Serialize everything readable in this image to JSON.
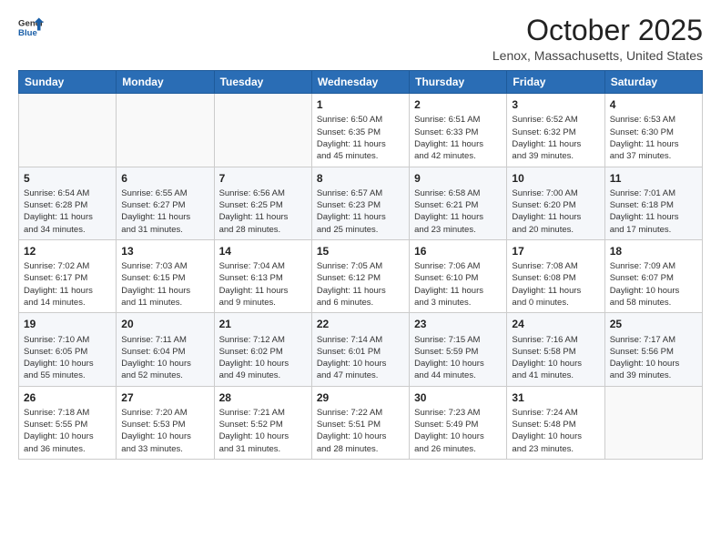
{
  "header": {
    "logo_general": "General",
    "logo_blue": "Blue",
    "month_title": "October 2025",
    "location": "Lenox, Massachusetts, United States"
  },
  "days_of_week": [
    "Sunday",
    "Monday",
    "Tuesday",
    "Wednesday",
    "Thursday",
    "Friday",
    "Saturday"
  ],
  "weeks": [
    [
      {
        "day": "",
        "info": ""
      },
      {
        "day": "",
        "info": ""
      },
      {
        "day": "",
        "info": ""
      },
      {
        "day": "1",
        "info": "Sunrise: 6:50 AM\nSunset: 6:35 PM\nDaylight: 11 hours\nand 45 minutes."
      },
      {
        "day": "2",
        "info": "Sunrise: 6:51 AM\nSunset: 6:33 PM\nDaylight: 11 hours\nand 42 minutes."
      },
      {
        "day": "3",
        "info": "Sunrise: 6:52 AM\nSunset: 6:32 PM\nDaylight: 11 hours\nand 39 minutes."
      },
      {
        "day": "4",
        "info": "Sunrise: 6:53 AM\nSunset: 6:30 PM\nDaylight: 11 hours\nand 37 minutes."
      }
    ],
    [
      {
        "day": "5",
        "info": "Sunrise: 6:54 AM\nSunset: 6:28 PM\nDaylight: 11 hours\nand 34 minutes."
      },
      {
        "day": "6",
        "info": "Sunrise: 6:55 AM\nSunset: 6:27 PM\nDaylight: 11 hours\nand 31 minutes."
      },
      {
        "day": "7",
        "info": "Sunrise: 6:56 AM\nSunset: 6:25 PM\nDaylight: 11 hours\nand 28 minutes."
      },
      {
        "day": "8",
        "info": "Sunrise: 6:57 AM\nSunset: 6:23 PM\nDaylight: 11 hours\nand 25 minutes."
      },
      {
        "day": "9",
        "info": "Sunrise: 6:58 AM\nSunset: 6:21 PM\nDaylight: 11 hours\nand 23 minutes."
      },
      {
        "day": "10",
        "info": "Sunrise: 7:00 AM\nSunset: 6:20 PM\nDaylight: 11 hours\nand 20 minutes."
      },
      {
        "day": "11",
        "info": "Sunrise: 7:01 AM\nSunset: 6:18 PM\nDaylight: 11 hours\nand 17 minutes."
      }
    ],
    [
      {
        "day": "12",
        "info": "Sunrise: 7:02 AM\nSunset: 6:17 PM\nDaylight: 11 hours\nand 14 minutes."
      },
      {
        "day": "13",
        "info": "Sunrise: 7:03 AM\nSunset: 6:15 PM\nDaylight: 11 hours\nand 11 minutes."
      },
      {
        "day": "14",
        "info": "Sunrise: 7:04 AM\nSunset: 6:13 PM\nDaylight: 11 hours\nand 9 minutes."
      },
      {
        "day": "15",
        "info": "Sunrise: 7:05 AM\nSunset: 6:12 PM\nDaylight: 11 hours\nand 6 minutes."
      },
      {
        "day": "16",
        "info": "Sunrise: 7:06 AM\nSunset: 6:10 PM\nDaylight: 11 hours\nand 3 minutes."
      },
      {
        "day": "17",
        "info": "Sunrise: 7:08 AM\nSunset: 6:08 PM\nDaylight: 11 hours\nand 0 minutes."
      },
      {
        "day": "18",
        "info": "Sunrise: 7:09 AM\nSunset: 6:07 PM\nDaylight: 10 hours\nand 58 minutes."
      }
    ],
    [
      {
        "day": "19",
        "info": "Sunrise: 7:10 AM\nSunset: 6:05 PM\nDaylight: 10 hours\nand 55 minutes."
      },
      {
        "day": "20",
        "info": "Sunrise: 7:11 AM\nSunset: 6:04 PM\nDaylight: 10 hours\nand 52 minutes."
      },
      {
        "day": "21",
        "info": "Sunrise: 7:12 AM\nSunset: 6:02 PM\nDaylight: 10 hours\nand 49 minutes."
      },
      {
        "day": "22",
        "info": "Sunrise: 7:14 AM\nSunset: 6:01 PM\nDaylight: 10 hours\nand 47 minutes."
      },
      {
        "day": "23",
        "info": "Sunrise: 7:15 AM\nSunset: 5:59 PM\nDaylight: 10 hours\nand 44 minutes."
      },
      {
        "day": "24",
        "info": "Sunrise: 7:16 AM\nSunset: 5:58 PM\nDaylight: 10 hours\nand 41 minutes."
      },
      {
        "day": "25",
        "info": "Sunrise: 7:17 AM\nSunset: 5:56 PM\nDaylight: 10 hours\nand 39 minutes."
      }
    ],
    [
      {
        "day": "26",
        "info": "Sunrise: 7:18 AM\nSunset: 5:55 PM\nDaylight: 10 hours\nand 36 minutes."
      },
      {
        "day": "27",
        "info": "Sunrise: 7:20 AM\nSunset: 5:53 PM\nDaylight: 10 hours\nand 33 minutes."
      },
      {
        "day": "28",
        "info": "Sunrise: 7:21 AM\nSunset: 5:52 PM\nDaylight: 10 hours\nand 31 minutes."
      },
      {
        "day": "29",
        "info": "Sunrise: 7:22 AM\nSunset: 5:51 PM\nDaylight: 10 hours\nand 28 minutes."
      },
      {
        "day": "30",
        "info": "Sunrise: 7:23 AM\nSunset: 5:49 PM\nDaylight: 10 hours\nand 26 minutes."
      },
      {
        "day": "31",
        "info": "Sunrise: 7:24 AM\nSunset: 5:48 PM\nDaylight: 10 hours\nand 23 minutes."
      },
      {
        "day": "",
        "info": ""
      }
    ]
  ]
}
